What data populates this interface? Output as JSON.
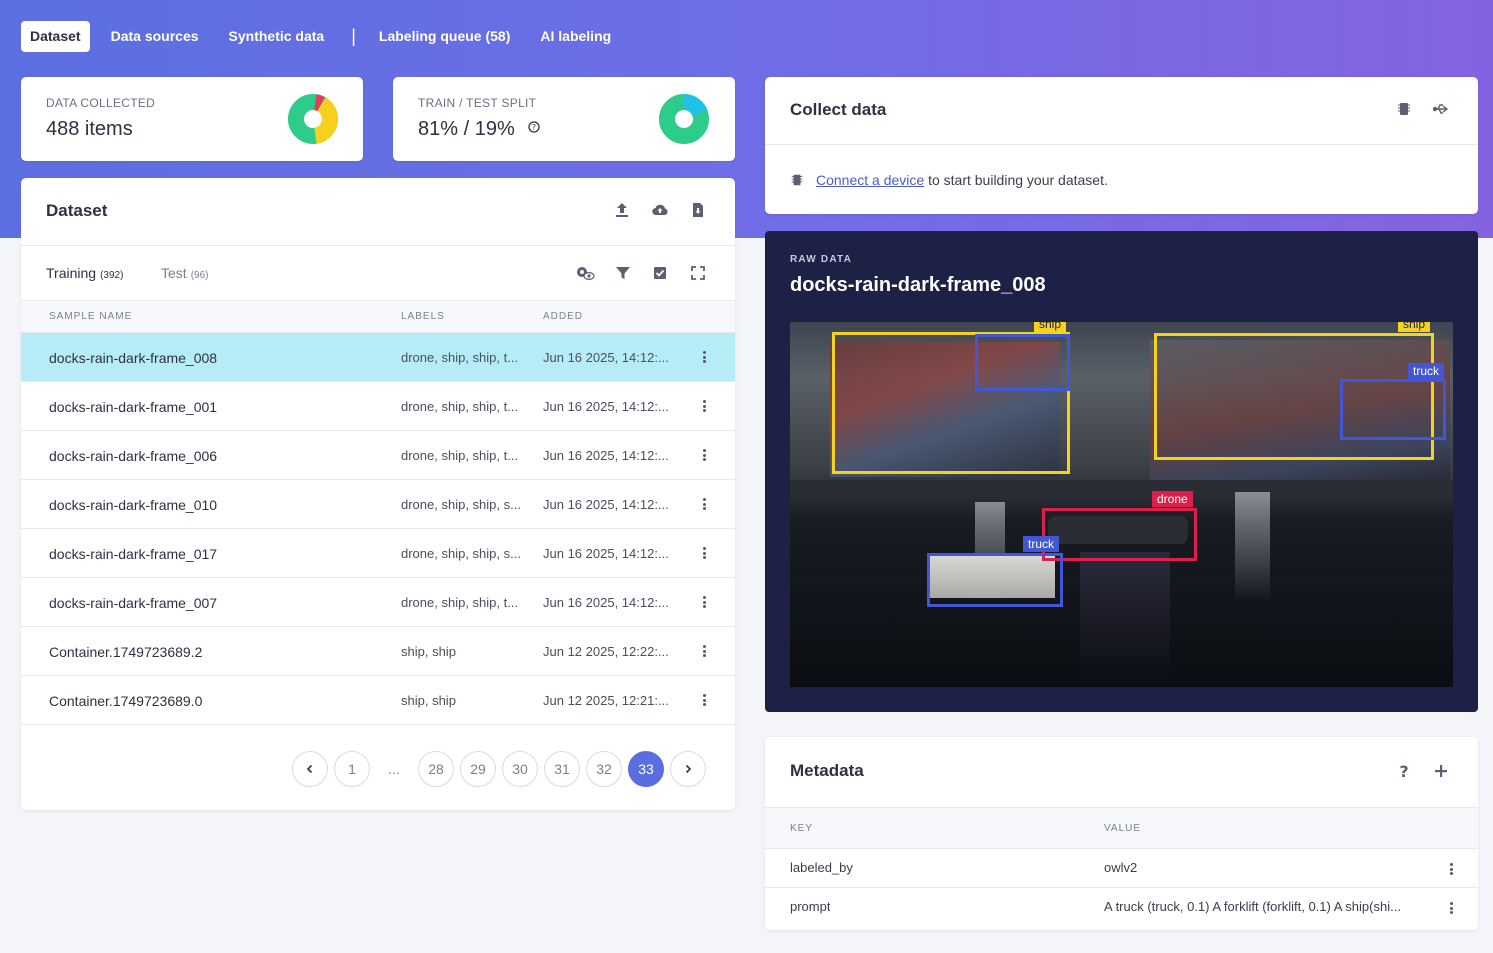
{
  "nav": {
    "tabs": [
      "Dataset",
      "Data sources",
      "Synthetic data"
    ],
    "tabs_right": [
      "Labeling queue (58)",
      "AI labeling"
    ],
    "separator": "|"
  },
  "stats": {
    "collected_label": "DATA COLLECTED",
    "collected_value": "488 items",
    "split_label": "TRAIN / TEST SPLIT",
    "split_value": "81% / 19%",
    "split_help_icon": "question-circle-icon"
  },
  "dataset": {
    "title": "Dataset",
    "tabs": [
      {
        "label": "Training",
        "count": "(392)"
      },
      {
        "label": "Test",
        "count": "(96)"
      }
    ],
    "columns": [
      "SAMPLE NAME",
      "LABELS",
      "ADDED"
    ],
    "rows": [
      {
        "name": "docks-rain-dark-frame_008",
        "labels": "drone, ship, ship, t...",
        "added": "Jun 16 2025, 14:12:..."
      },
      {
        "name": "docks-rain-dark-frame_001",
        "labels": "drone, ship, ship, t...",
        "added": "Jun 16 2025, 14:12:..."
      },
      {
        "name": "docks-rain-dark-frame_006",
        "labels": "drone, ship, ship, t...",
        "added": "Jun 16 2025, 14:12:..."
      },
      {
        "name": "docks-rain-dark-frame_010",
        "labels": "drone, ship, ship, s...",
        "added": "Jun 16 2025, 14:12:..."
      },
      {
        "name": "docks-rain-dark-frame_017",
        "labels": "drone, ship, ship, s...",
        "added": "Jun 16 2025, 14:12:..."
      },
      {
        "name": "docks-rain-dark-frame_007",
        "labels": "drone, ship, ship, t...",
        "added": "Jun 16 2025, 14:12:..."
      },
      {
        "name": "Container.1749723689.2",
        "labels": "ship, ship",
        "added": "Jun 12 2025, 12:22:..."
      },
      {
        "name": "Container.1749723689.0",
        "labels": "ship, ship",
        "added": "Jun 12 2025, 12:21:..."
      }
    ],
    "pagination": {
      "pages": [
        "1",
        "...",
        "28",
        "29",
        "30",
        "31",
        "32",
        "33"
      ],
      "current": "33"
    }
  },
  "collect": {
    "title": "Collect data",
    "link": "Connect a device",
    "text": " to start building your dataset."
  },
  "raw": {
    "label": "RAW DATA",
    "title": "docks-rain-dark-frame_008",
    "boxes": [
      "ship",
      "ship",
      "truck",
      "drone",
      "truck"
    ]
  },
  "metadata": {
    "title": "Metadata",
    "columns": [
      "KEY",
      "VALUE"
    ],
    "rows": [
      {
        "key": "labeled_by",
        "value": "owlv2"
      },
      {
        "key": "prompt",
        "value": "A truck (truck, 0.1) A forklift (forklift, 0.1) A ship(shi..."
      }
    ]
  },
  "colors": {
    "accent": "#5b6ee0",
    "selected_row": "#b6ecf6",
    "ship": "#f5d21c",
    "truck": "#4256d6",
    "drone": "#dc1f4b"
  }
}
